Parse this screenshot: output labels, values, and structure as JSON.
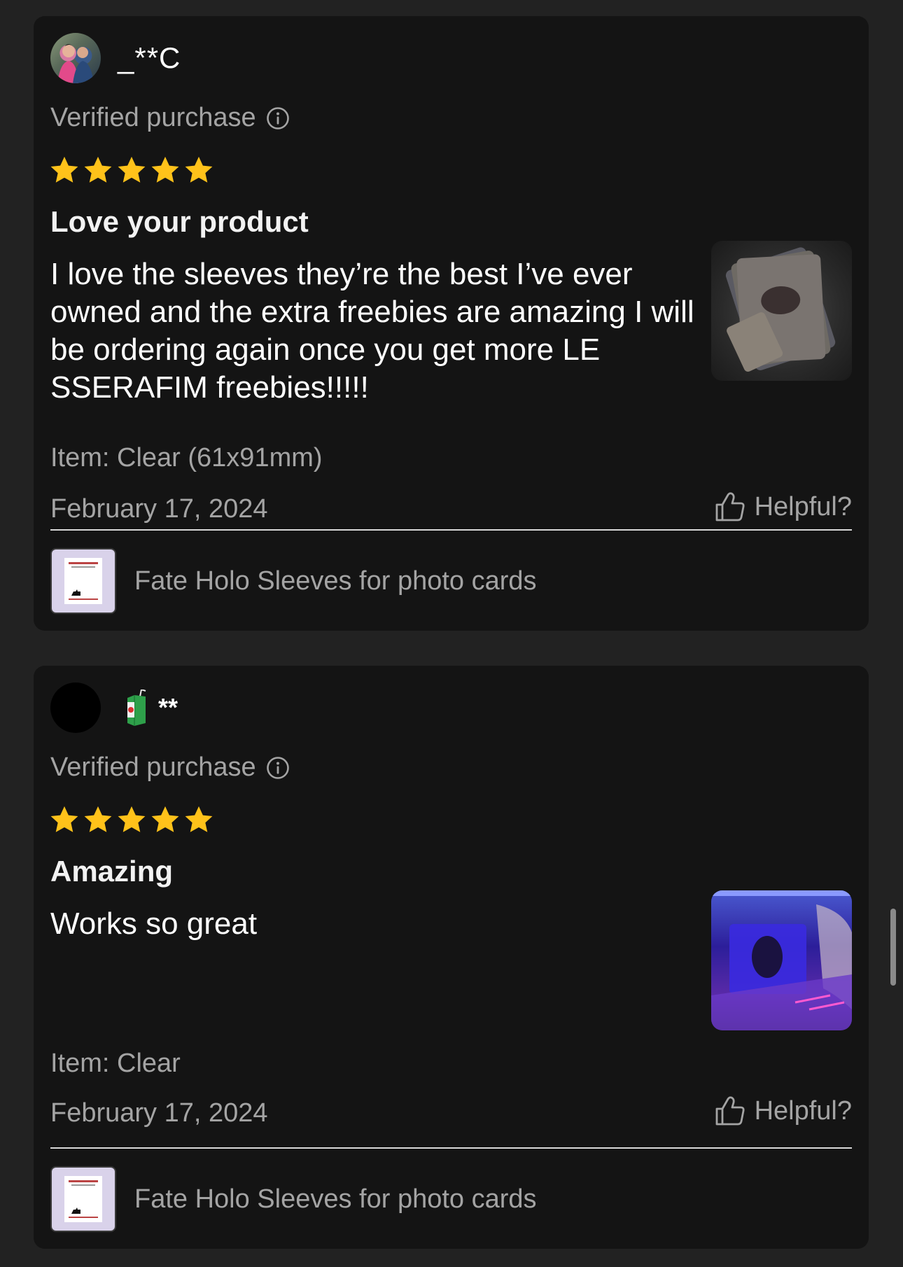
{
  "colors": {
    "page_bg": "#222222",
    "card_bg": "#141414",
    "star": "#FFC21A",
    "muted_text": "#A4A4A4",
    "divider": "#D8D8D8"
  },
  "reviews": [
    {
      "username": "_**C",
      "avatar": "user-photo-avatar",
      "verified_label": "Verified purchase",
      "rating": 5,
      "title": "Love your product",
      "body": "I love the sleeves they’re the best I’ve ever owned and the extra freebies are amazing I will be ordering again once you get more LE SSERAFIM freebies!!!!!",
      "item": "Item: Clear (61x91mm)",
      "date": "February 17, 2024",
      "helpful_label": "Helpful?",
      "product_name": "Fate Holo Sleeves for photo cards"
    },
    {
      "username": "**",
      "avatar": "black-avatar",
      "username_icon": "juice-box-icon",
      "verified_label": "Verified purchase",
      "rating": 5,
      "title": "Amazing",
      "body": "Works so great",
      "item": "Item: Clear",
      "date": "February 17, 2024",
      "helpful_label": "Helpful?",
      "product_name": "Fate Holo Sleeves for photo cards"
    }
  ]
}
